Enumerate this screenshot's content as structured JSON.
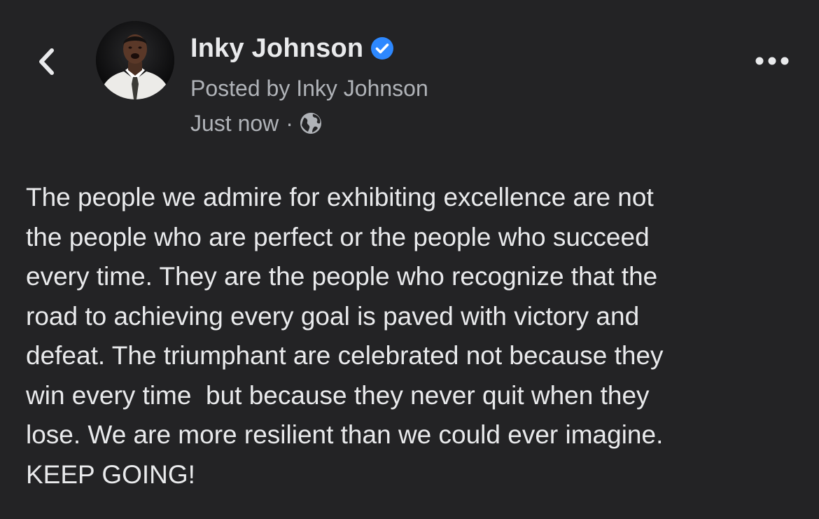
{
  "header": {
    "back_icon": "chevron-left-icon",
    "avatar_icon": "profile-photo",
    "author_name": "Inky Johnson",
    "verified_icon": "verified-badge-icon",
    "verified_color": "#2d88ff",
    "posted_by": "Posted by Inky Johnson",
    "timestamp": "Just now",
    "separator": "·",
    "audience_icon": "globe-icon",
    "more_icon": "more-horizontal-icon"
  },
  "post": {
    "text": "The people we admire for exhibiting excellence are not\nthe people who are perfect or the people who succeed\nevery time. They are the people who recognize that the\nroad to achieving every goal is paved with victory and\ndefeat. The triumphant are celebrated not because they\nwin every time  but because they never quit when they\nlose. We are more resilient than we could ever imagine.\nKEEP GOING!"
  },
  "theme": {
    "background": "#232325",
    "primary_text": "#e9eaec",
    "secondary_text": "#b0b3b8"
  }
}
